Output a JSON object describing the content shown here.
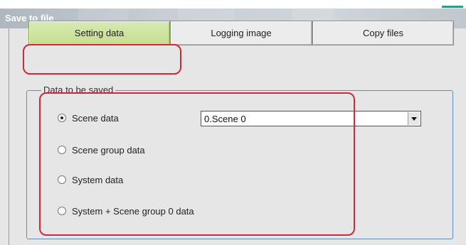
{
  "window": {
    "title": "Save to file"
  },
  "tabs": [
    {
      "label": "Setting data",
      "active": true
    },
    {
      "label": "Logging image",
      "active": false
    },
    {
      "label": "Copy files",
      "active": false
    }
  ],
  "group": {
    "title": "Data to be saved",
    "options": [
      {
        "label": "Scene data",
        "checked": true
      },
      {
        "label": "Scene group data",
        "checked": false
      },
      {
        "label": "System data",
        "checked": false
      },
      {
        "label": "System + Scene group 0 data",
        "checked": false
      }
    ],
    "scene_select": {
      "value": "0.Scene 0"
    }
  },
  "colors": {
    "highlight": "#cc2a36",
    "active_tab": "#c4df90",
    "group_border": "#5a8fc4"
  }
}
